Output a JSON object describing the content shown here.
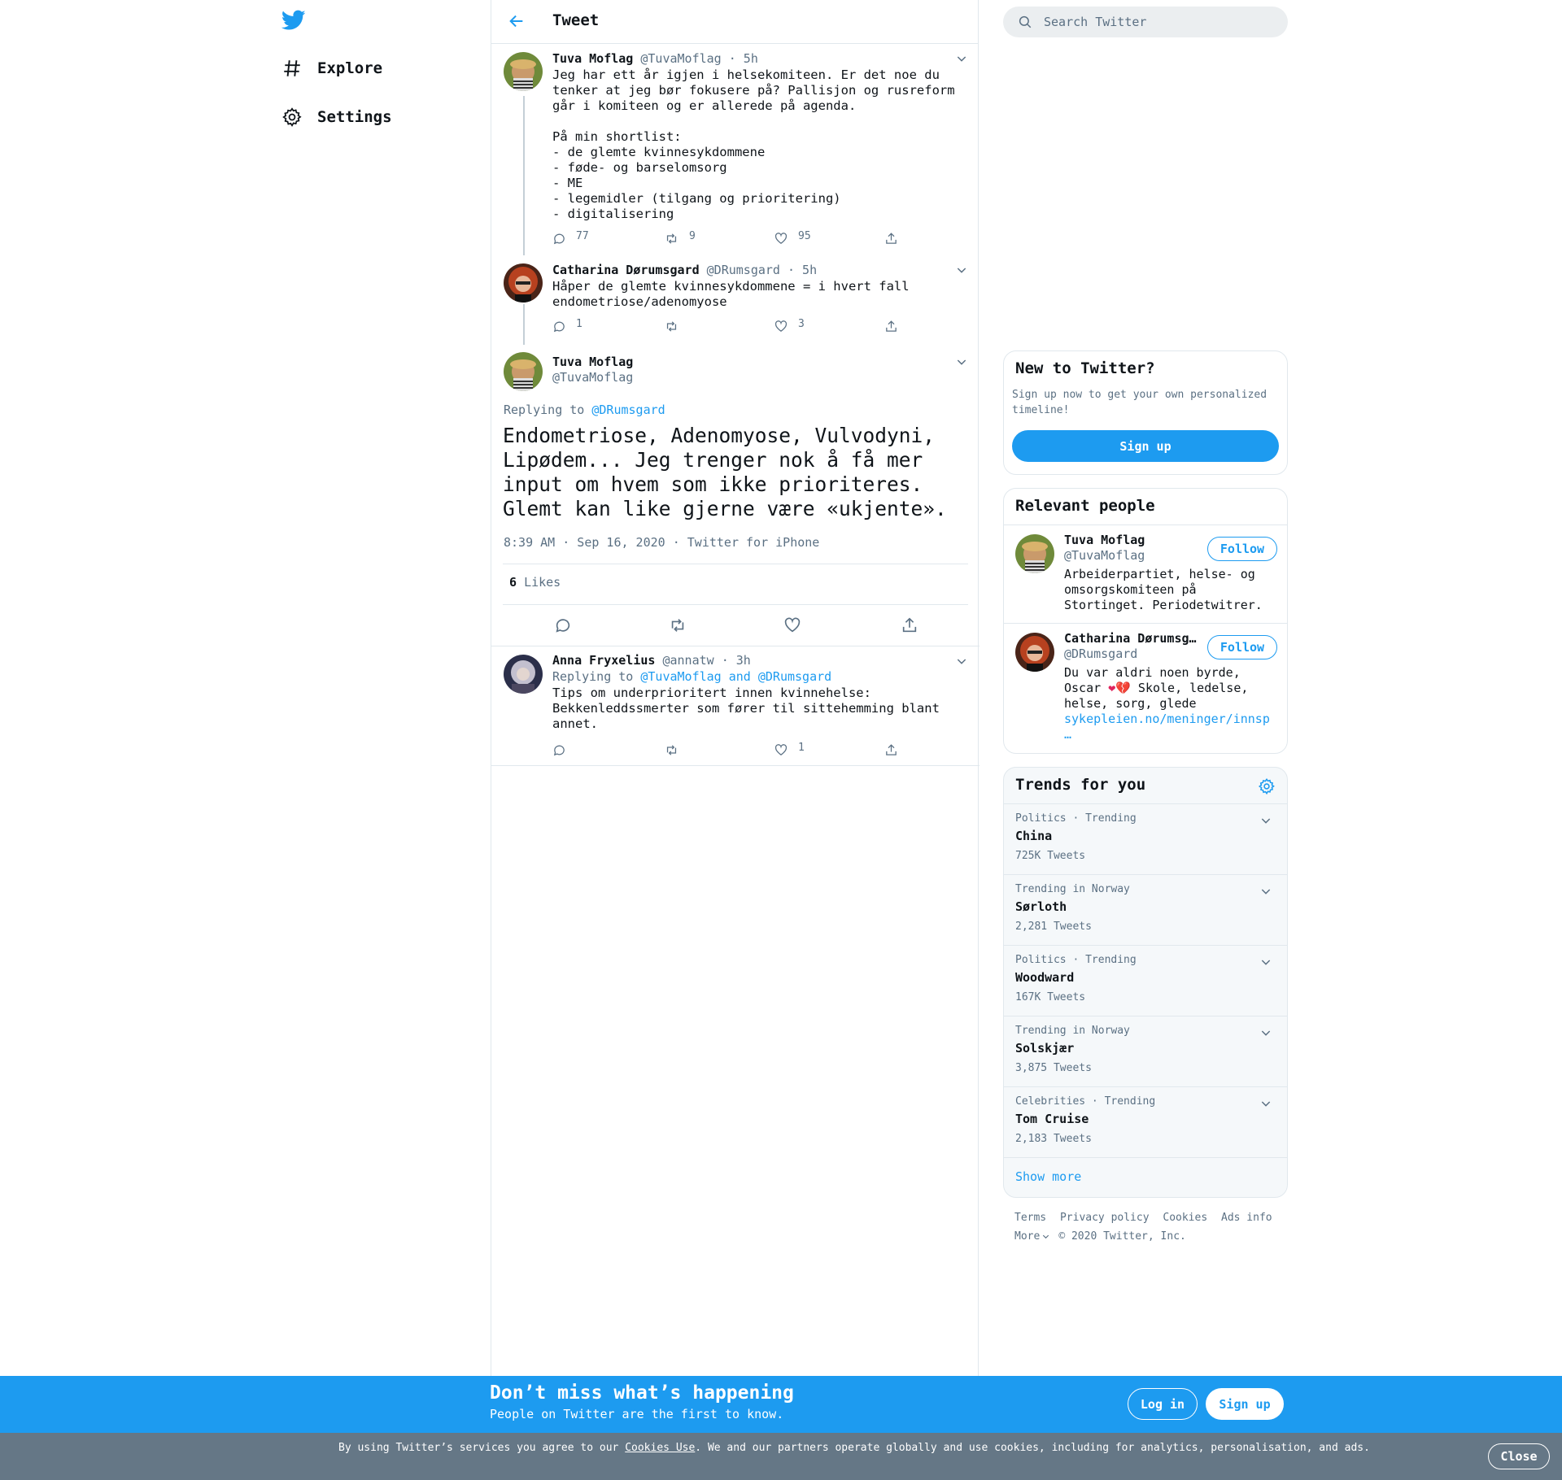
{
  "nav": {
    "explore": "Explore",
    "settings": "Settings"
  },
  "header": {
    "title": "Tweet"
  },
  "thread": [
    {
      "name": "Tuva Moflag",
      "handle": "@TuvaMoflag",
      "time": "· 5h",
      "text": "Jeg har ett år igjen i helsekomiteen. Er det noe du tenker at jeg bør fokusere på? Pallisjon og rusreform går i komiteen og er allerede på agenda.\n\nPå min shortlist:\n- de glemte kvinnesykdommene\n- føde- og barselomsorg\n- ME\n- legemidler (tilgang og prioritering)\n- digitalisering",
      "replies": "77",
      "retweets": "9",
      "likes": "95"
    },
    {
      "name": "Catharina Dørumsgard",
      "handle": "@DRumsgard",
      "time": "· 5h",
      "text": "Håper de glemte kvinnesykdommene = i hvert fall endometriose/adenomyose",
      "replies": "1",
      "retweets": "",
      "likes": "3"
    }
  ],
  "main_tweet": {
    "name": "Tuva Moflag",
    "handle": "@TuvaMoflag",
    "replying_prefix": "Replying to ",
    "replying_to": "@DRumsgard",
    "text": "Endometriose, Adenomyose, Vulvodyni, Lipødem... Jeg trenger nok å få mer input om hvem som ikke prioriteres. Glemt kan like gjerne være «ukjente».",
    "datetime": "8:39 AM · Sep 16, 2020",
    "source": "· Twitter for iPhone",
    "likes_count": "6",
    "likes_label": "Likes"
  },
  "reply": {
    "name": "Anna Fryxelius",
    "handle": "@annatw",
    "time": "· 3h",
    "replying_prefix": "Replying to ",
    "replying_to_1": "@TuvaMoflag",
    "replying_and": " and ",
    "replying_to_2": "@DRumsgard",
    "text": "Tips om underprioritert innen kvinnehelse: Bekkenleddssmerter som fører til sittehemming blant annet.",
    "replies": "",
    "retweets": "",
    "likes": "1"
  },
  "search": {
    "placeholder": "Search Twitter"
  },
  "signup_card": {
    "title": "New to Twitter?",
    "text": "Sign up now to get your own personalized timeline!",
    "button": "Sign up"
  },
  "relevant": {
    "title": "Relevant people",
    "people": [
      {
        "name": "Tuva Moflag",
        "handle": "@TuvaMoflag",
        "bio": "Arbeiderpartiet, helse- og omsorgskomiteen på Stortinget. Periodetwitrer.",
        "follow": "Follow"
      },
      {
        "name": "Catharina Dørumsgard",
        "handle": "@DRumsgard",
        "bio_prefix": "Du var aldri noen byrde, Oscar ",
        "bio_emoji": "❤💔",
        "bio_suffix": " Skole, ledelse, helse, sorg, glede",
        "bio_link": "sykepleien.no/meninger/innsp",
        "bio_ellipsis": "…",
        "follow": "Follow"
      }
    ]
  },
  "trends": {
    "title": "Trends for you",
    "items": [
      {
        "context": "Politics · Trending",
        "name": "China",
        "count": "725K Tweets"
      },
      {
        "context": "Trending in Norway",
        "name": "Sørloth",
        "count": "2,281 Tweets"
      },
      {
        "context": "Politics · Trending",
        "name": "Woodward",
        "count": "167K Tweets"
      },
      {
        "context": "Trending in Norway",
        "name": "Solskjær",
        "count": "3,875 Tweets"
      },
      {
        "context": "Celebrities · Trending",
        "name": "Tom Cruise",
        "count": "2,183 Tweets"
      }
    ],
    "show_more": "Show more"
  },
  "footer": {
    "terms": "Terms",
    "privacy": "Privacy policy",
    "cookies": "Cookies",
    "ads": "Ads info",
    "more": "More",
    "copyright": "© 2020 Twitter, Inc."
  },
  "bottom_bar": {
    "title": "Don’t miss what’s happening",
    "subtitle": "People on Twitter are the first to know.",
    "login": "Log in",
    "signup": "Sign up"
  },
  "cookie_bar": {
    "text_before": "By using Twitter’s services you agree to our ",
    "link": "Cookies Use",
    "text_after": ". We and our partners operate globally and use cookies, including for analytics, personalisation, and ads.",
    "close": "Close"
  },
  "colors": {
    "accent": "#1d9bf0",
    "muted": "#5b7083",
    "border": "#e1e8ed",
    "cookie_bar": "#657786"
  }
}
